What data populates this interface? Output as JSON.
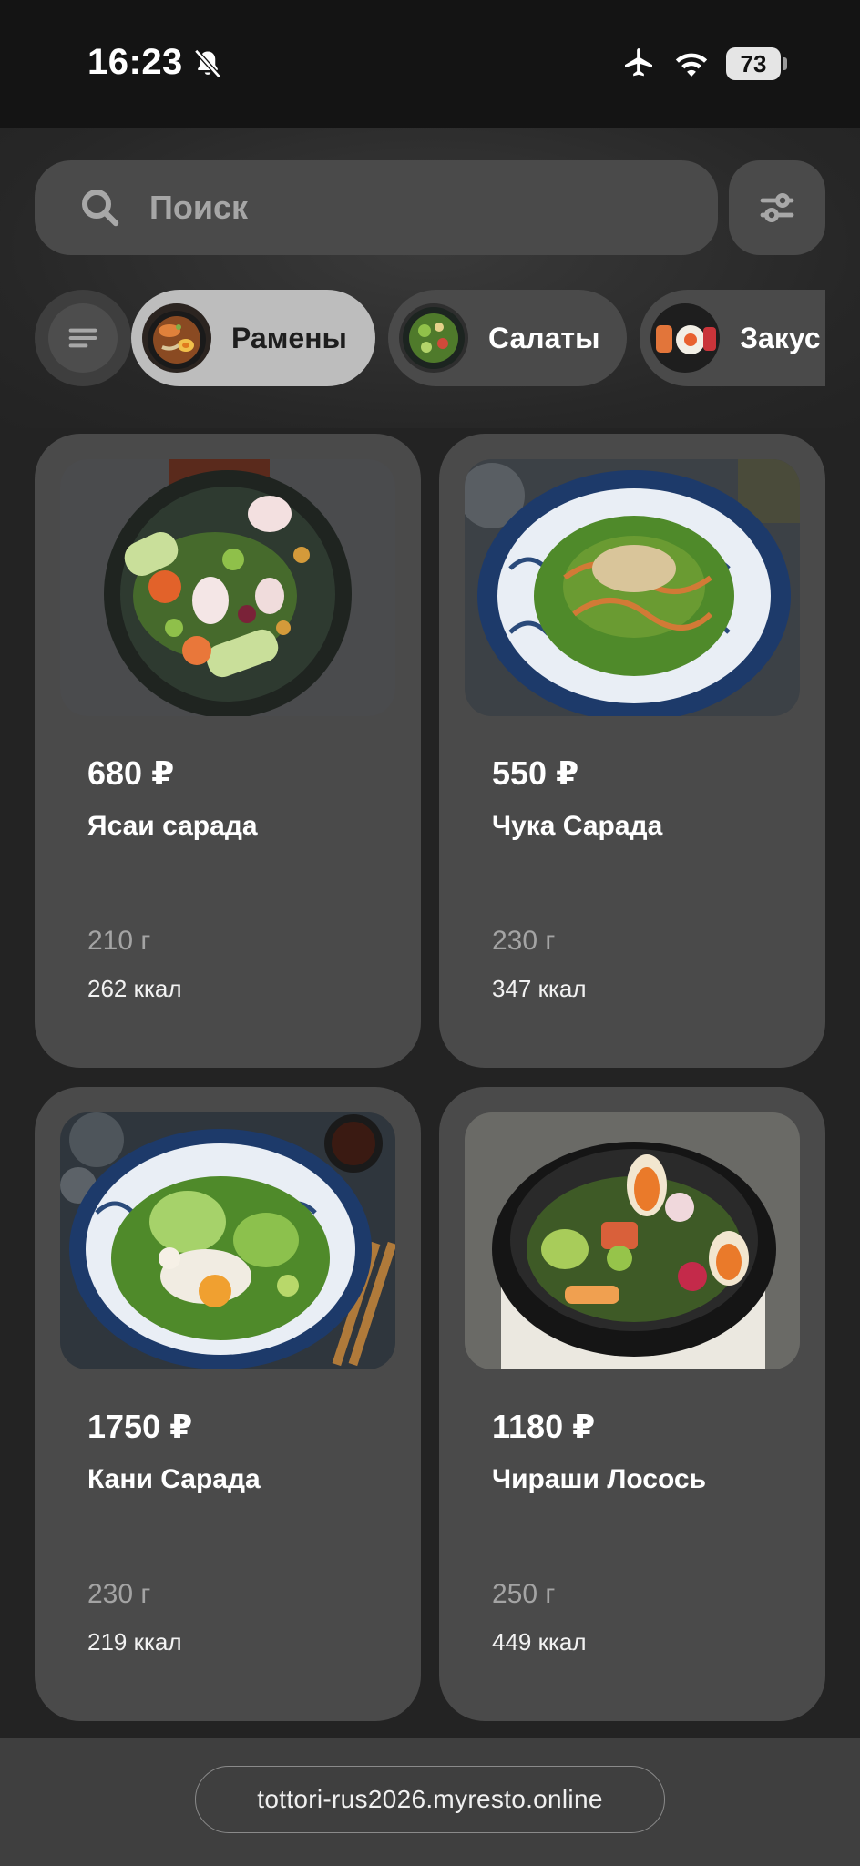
{
  "status_bar": {
    "time": "16:23",
    "battery": "73",
    "icons": [
      "bell-slash-icon",
      "airplane-icon",
      "wifi-icon",
      "battery-icon"
    ]
  },
  "search": {
    "placeholder": "Поиск",
    "value": ""
  },
  "categories": [
    {
      "label": "Рамены",
      "active": true
    },
    {
      "label": "Салаты",
      "active": false
    },
    {
      "label": "Закус",
      "active": false
    }
  ],
  "products": [
    {
      "price": "680 ₽",
      "name": "Ясаи сарада",
      "weight": "210 г",
      "kcal": "262 ккал"
    },
    {
      "price": "550 ₽",
      "name": "Чука Сарада",
      "weight": "230 г",
      "kcal": "347 ккал"
    },
    {
      "price": "1750 ₽",
      "name": "Кани Сарада",
      "weight": "230 г",
      "kcal": "219 ккал"
    },
    {
      "price": "1180 ₽",
      "name": "Чираши Лосось",
      "weight": "250 г",
      "kcal": "449 ккал"
    }
  ],
  "footer": {
    "url": "tottori-rus2026.myresto.online"
  },
  "colors": {
    "background": "#232323",
    "card": "#4a4a4a",
    "active_chip": "#bdbdbd",
    "status_bar": "#141414"
  }
}
